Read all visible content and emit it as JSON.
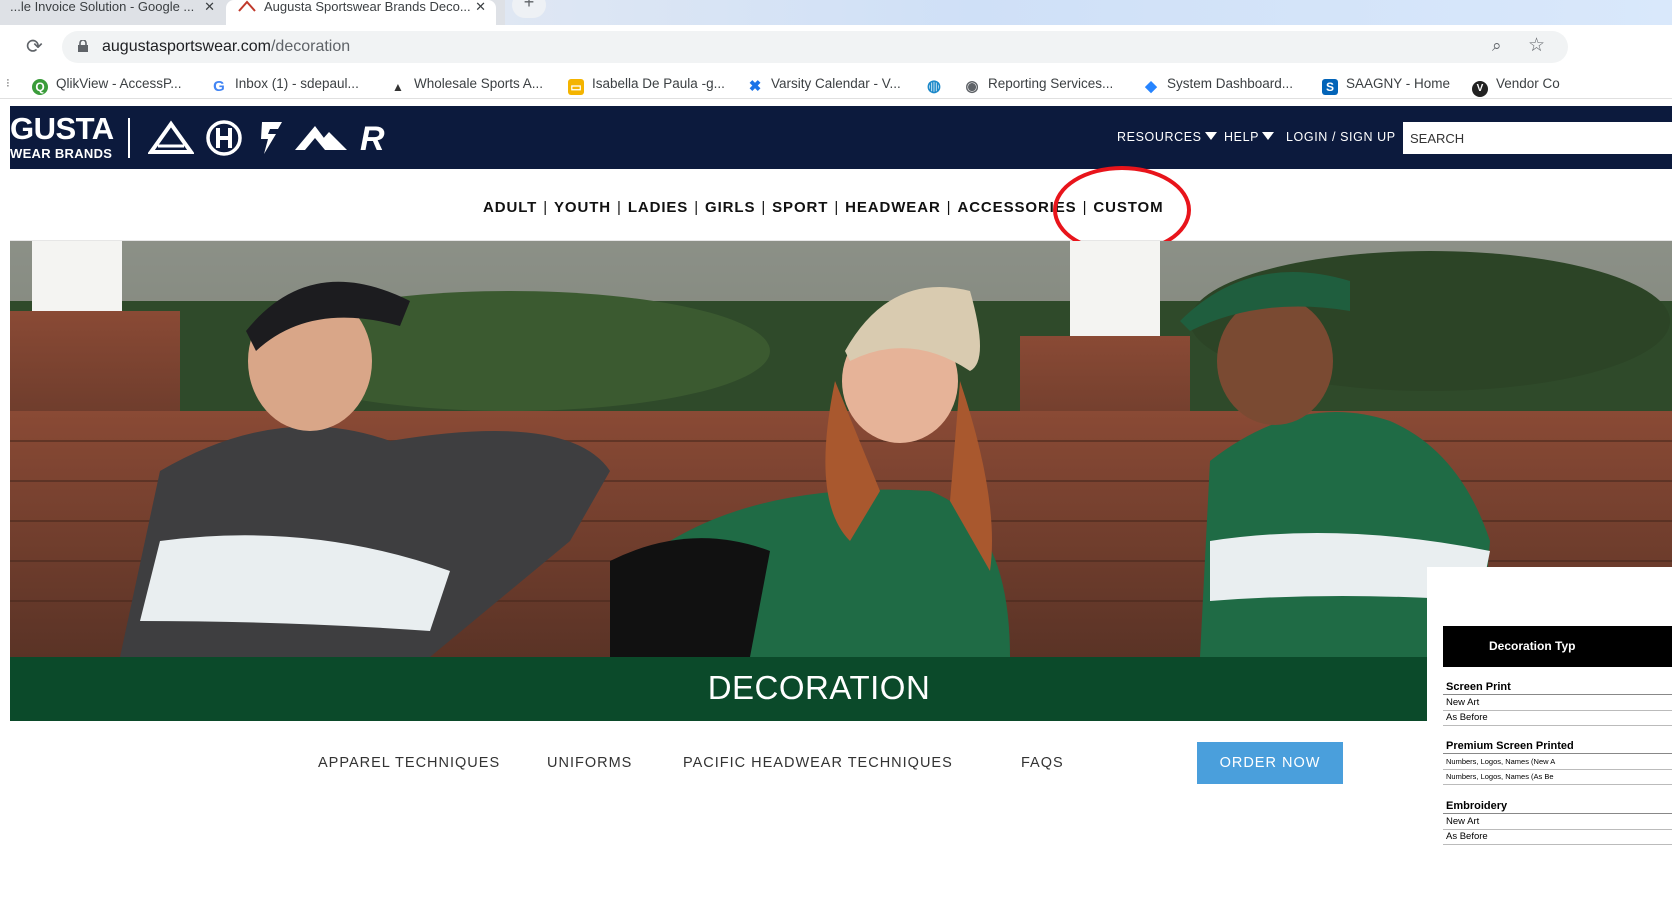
{
  "browser": {
    "tabs": [
      {
        "title": "...le Invoice Solution - Google ...",
        "close": "✕"
      },
      {
        "title": "Augusta Sportswear Brands Deco...",
        "close": "✕"
      }
    ],
    "new_tab": "+",
    "url_host": "augustasportswear.com",
    "url_path": "/decoration",
    "bookmarks": [
      {
        "label": "QlikView - AccessP...",
        "icon": "qlikview-icon",
        "glyph": "Q",
        "color": "#3a9c3a"
      },
      {
        "label": "Inbox (1) - sdepaul...",
        "icon": "google-icon",
        "glyph": "G",
        "color": "#4285f4"
      },
      {
        "label": "Wholesale Sports A...",
        "icon": "augusta-icon",
        "glyph": "▲",
        "color": "#333333"
      },
      {
        "label": "Isabella De Paula -g...",
        "icon": "slides-icon",
        "glyph": "▭",
        "color": "#f4b400"
      },
      {
        "label": "Varsity Calendar - V...",
        "icon": "varsity-icon",
        "glyph": "✖",
        "color": "#1a73e8"
      },
      {
        "label": "",
        "icon": "att-icon",
        "glyph": "◍",
        "color": "#1a88c9"
      },
      {
        "label": "Reporting Services...",
        "icon": "globe-icon",
        "glyph": "◉",
        "color": "#5f6368"
      },
      {
        "label": "System Dashboard...",
        "icon": "jira-icon",
        "glyph": "◆",
        "color": "#2684ff"
      },
      {
        "label": "SAAGNY - Home",
        "icon": "sharepoint-icon",
        "glyph": "S",
        "color": "#0364b8"
      },
      {
        "label": "Vendor Co",
        "icon": "vendor-icon",
        "glyph": "V",
        "color": "#222222"
      }
    ]
  },
  "site": {
    "logo_main": "GUSTA",
    "logo_sub": "WEAR BRANDS",
    "header_nav": {
      "resources": "RESOURCES",
      "help": "HELP",
      "login": "LOGIN / SIGN UP",
      "search_placeholder": "SEARCH"
    },
    "categories": [
      "ADULT",
      "YOUTH",
      "LADIES",
      "GIRLS",
      "SPORT",
      "HEADWEAR",
      "ACCESSORIES",
      "CUSTOM"
    ],
    "category_separator": "|",
    "banner_title": "DECORATION",
    "subnav": [
      "APPAREL TECHNIQUES",
      "UNIFORMS",
      "PACIFIC HEADWEAR TECHNIQUES",
      "FAQS"
    ],
    "order_button": "ORDER NOW"
  },
  "price_table": {
    "header": "Decoration Typ",
    "sections": [
      {
        "title": "Screen Print",
        "rows": [
          "New Art",
          "As Before"
        ]
      },
      {
        "title": "Premium Screen Printed",
        "rows": [
          "Numbers, Logos, Names (New A",
          "Numbers, Logos, Names (As Be"
        ]
      },
      {
        "title": "Embroidery",
        "rows": [
          "New Art",
          "As Before"
        ]
      }
    ]
  },
  "colors": {
    "header_bg": "#0c1a3d",
    "banner_bg": "#0b4a2a",
    "order_button_bg": "#4a9fdc",
    "annotation_circle": "#e8141b"
  }
}
